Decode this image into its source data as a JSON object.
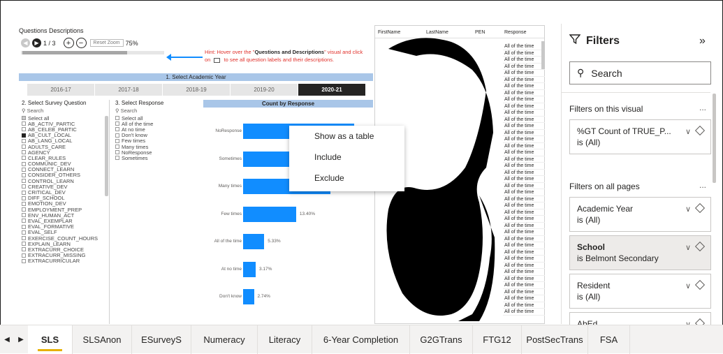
{
  "questions": {
    "title": "Questions Descriptions",
    "page_indicator": "1 / 3",
    "reset_zoom": "Reset Zoom",
    "zoom": "75%",
    "hint_prefix": "Hint: Hover over the \"",
    "hint_bold": "Questions and Descriptions",
    "hint_mid": "\" visual and click on",
    "hint_suffix": "to see all question labels and their descriptions."
  },
  "academic_year": {
    "title": "1. Select Academic Year",
    "years": [
      "2016-17",
      "2017-18",
      "2018-19",
      "2019-20",
      "2020-21"
    ],
    "selected": "2020-21"
  },
  "survey_question": {
    "title": "2. Select Survey Question",
    "search": "Search",
    "items": [
      {
        "label": "Select all",
        "state": "partial"
      },
      {
        "label": "AB_ACTIV_PARTIC",
        "state": "off"
      },
      {
        "label": "AB_CELEB_PARTIC",
        "state": "off"
      },
      {
        "label": "AB_CULT_LOCAL",
        "state": "on"
      },
      {
        "label": "AB_LANG_LOCAL",
        "state": "off"
      },
      {
        "label": "ADULTS_CARE",
        "state": "off"
      },
      {
        "label": "AGENCY",
        "state": "off"
      },
      {
        "label": "CLEAR_RULES",
        "state": "off"
      },
      {
        "label": "COMMUNIC_DEV",
        "state": "off"
      },
      {
        "label": "CONNECT_LEARN",
        "state": "off"
      },
      {
        "label": "CONSIDER_OTHERS",
        "state": "off"
      },
      {
        "label": "CONTROL_LEARN",
        "state": "off"
      },
      {
        "label": "CREATIVE_DEV",
        "state": "off"
      },
      {
        "label": "CRITICAL_DEV",
        "state": "off"
      },
      {
        "label": "DIFF_SCHOOL",
        "state": "off"
      },
      {
        "label": "EMOTION_DEV",
        "state": "off"
      },
      {
        "label": "EMPLOYMENT_PREP",
        "state": "off"
      },
      {
        "label": "ENV_HUMAN_ACT",
        "state": "off"
      },
      {
        "label": "EVAL_EXEMPLAR",
        "state": "off"
      },
      {
        "label": "EVAL_FORMATIVE",
        "state": "off"
      },
      {
        "label": "EVAL_SELF",
        "state": "off"
      },
      {
        "label": "EXERCISE_COUNT_HOURS",
        "state": "off"
      },
      {
        "label": "EXPLAIN_LEARN",
        "state": "off"
      },
      {
        "label": "EXTRACURR_CHOICE",
        "state": "off"
      },
      {
        "label": "EXTRACURR_MISSING",
        "state": "off"
      },
      {
        "label": "EXTRACURRICULAR",
        "state": "off"
      }
    ]
  },
  "response_filter": {
    "title": "3. Select Response",
    "search": "Search",
    "items": [
      "Select all",
      "All of the time",
      "At no time",
      "Don't know",
      "Few times",
      "Many times",
      "NoResponse",
      "Sometimes"
    ]
  },
  "chart_data": {
    "type": "bar",
    "title": "Count by Response",
    "categories": [
      "NoResponse",
      "Sometimes",
      "Many times",
      "Few times",
      "All of the time",
      "At no time",
      "Don't know"
    ],
    "values": [
      null,
      null,
      null,
      13.4,
      5.33,
      3.17,
      2.74
    ],
    "value_labels": [
      "",
      "",
      "",
      "13.40%",
      "5.33%",
      "3.17%",
      "2.74%"
    ],
    "orientation": "horizontal"
  },
  "table": {
    "columns": [
      "FirstName",
      "LastName",
      "PEN",
      "Response"
    ],
    "response_values": [
      "All of the time",
      "All of the time",
      "All of the time",
      "All of the time",
      "All of the time",
      "All of the time",
      "All of the time",
      "All of the time",
      "All of the time",
      "All of the time",
      "All of the time",
      "All of the time",
      "All of the time",
      "All of the time",
      "All of the time",
      "All of the time",
      "All of the time",
      "All of the time",
      "All of the time",
      "All of the time",
      "All of the time",
      "All of the time",
      "All of the time",
      "All of the time",
      "All of the time",
      "All of the time",
      "All of the time",
      "All of the time",
      "All of the time",
      "All of the time",
      "All of the time",
      "All of the time",
      "All of the time",
      "All of the time",
      "All of the time",
      "All of the time",
      "All of the time",
      "All of the time",
      "All of the time",
      "All of the time",
      "All of the time"
    ]
  },
  "context_menu": {
    "items": [
      "Show as a table",
      "Include",
      "Exclude"
    ]
  },
  "filters": {
    "title": "Filters",
    "search": "Search",
    "on_visual_label": "Filters on this visual",
    "on_all_pages_label": "Filters on all pages",
    "more": "...",
    "visual_cards": [
      {
        "name": "%GT Count of TRUE_P...",
        "value": "is (All)"
      }
    ],
    "page_cards": [
      {
        "name": "Academic Year",
        "value": "is (All)",
        "bold": false
      },
      {
        "name": "School",
        "value": "is Belmont Secondary",
        "bold": true
      },
      {
        "name": "Resident",
        "value": "is (All)",
        "bold": false
      },
      {
        "name": "AbEd",
        "value": "",
        "bold": false
      }
    ]
  },
  "tabs": [
    "SLS",
    "SLSAnon",
    "ESurveyS",
    "Numeracy",
    "Literacy",
    "6-Year Completion",
    "G2GTrans",
    "FTG12",
    "PostSecTrans",
    "FSA"
  ],
  "active_tab": "SLS"
}
